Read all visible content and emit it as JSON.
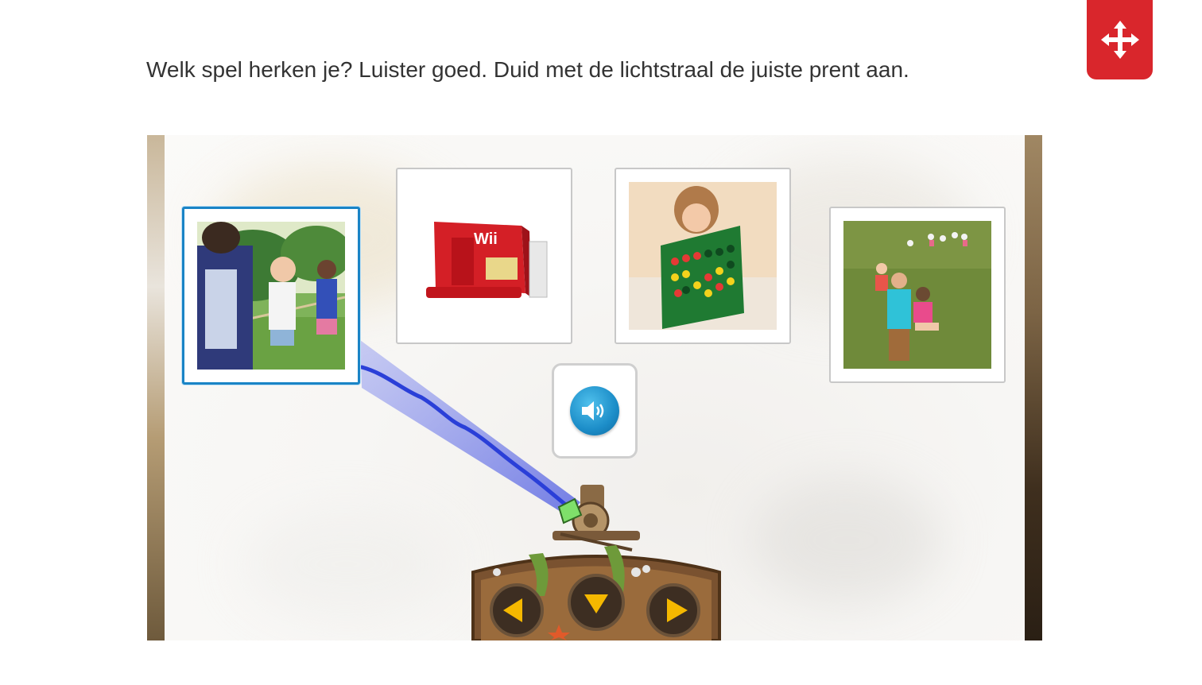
{
  "instruction": "Welk spel herken je? Luister goed. Duid met de lichtstraal de juiste prent aan.",
  "icons": {
    "move": "move-arrows-icon",
    "sound": "speaker-icon",
    "left": "arrow-left-icon",
    "down": "arrow-down-icon",
    "right": "arrow-right-icon"
  },
  "cards": [
    {
      "picture": "children playing tug of war",
      "selected": true
    },
    {
      "picture": "red Wii console box",
      "selected": false
    },
    {
      "picture": "girl with connect four game",
      "selected": false
    },
    {
      "picture": "children sitting in a circle on grass",
      "selected": false
    }
  ],
  "colors": {
    "accent_red": "#d9262c",
    "selection_blue": "#1a84c6",
    "beam_blue": "#2a3fd8",
    "control_arrow": "#f5b800"
  }
}
